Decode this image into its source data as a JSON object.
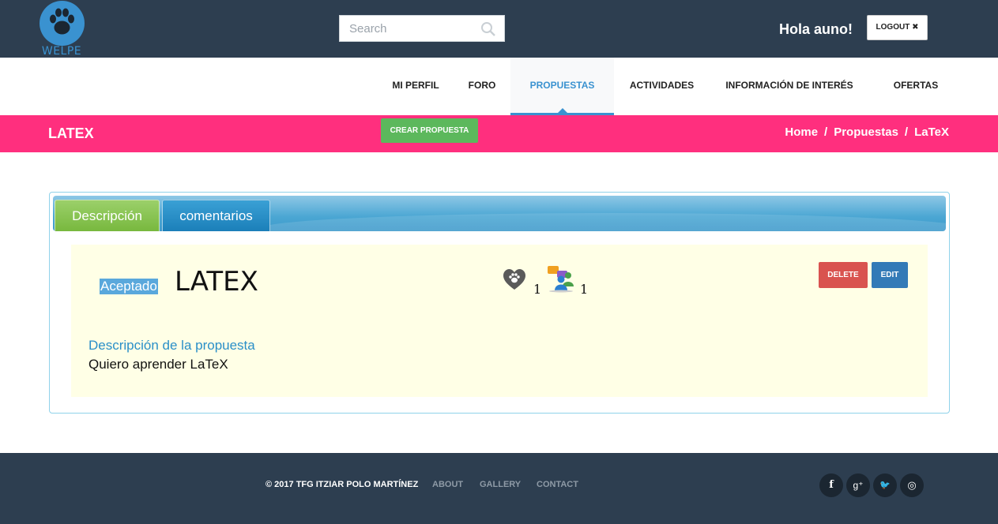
{
  "header": {
    "logo_text": "WELPE",
    "search_placeholder": "Search",
    "greeting": "Hola auno!",
    "logout_label": "LOGOUT ✖"
  },
  "nav": {
    "items": [
      {
        "label": "MI PERFIL"
      },
      {
        "label": "FORO"
      },
      {
        "label": "PROPUESTAS",
        "active": true
      },
      {
        "label": "ACTIVIDADES"
      },
      {
        "label": "INFORMACIÓN DE INTERÉS"
      },
      {
        "label": "OFERTAS"
      }
    ]
  },
  "band": {
    "title": "LATEX",
    "create_button": "CREAR PROPUESTA",
    "breadcrumb": [
      "Home",
      "Propuestas",
      "LaTeX"
    ],
    "separator": "/"
  },
  "panel": {
    "tabs": [
      {
        "label": "Descripción",
        "active": true
      },
      {
        "label": "comentarios"
      }
    ],
    "status": "Aceptado",
    "title": "LATEX",
    "likes": "1",
    "participants": "1",
    "delete_label": "DELETE",
    "edit_label": "EDIT",
    "description_label": "Descripción de la propuesta",
    "description_text": "Quiero aprender LaTeX"
  },
  "footer": {
    "copyright": "© 2017 TFG ITZIAR POLO MARTÍNEZ",
    "links": [
      "ABOUT",
      "GALLERY",
      "CONTACT"
    ],
    "social": [
      {
        "icon": "facebook-icon",
        "glyph": "f"
      },
      {
        "icon": "google-plus-icon",
        "glyph": "g⁺"
      },
      {
        "icon": "twitter-icon",
        "glyph": "🐦"
      },
      {
        "icon": "dribbble-icon",
        "glyph": "◎"
      }
    ]
  },
  "colors": {
    "topbar": "#2d3e50",
    "accent_pink": "#ff2f7e",
    "accent_blue": "#3a92d0",
    "success": "#5cb85c",
    "danger": "#d9534f",
    "primary": "#337ab7"
  }
}
